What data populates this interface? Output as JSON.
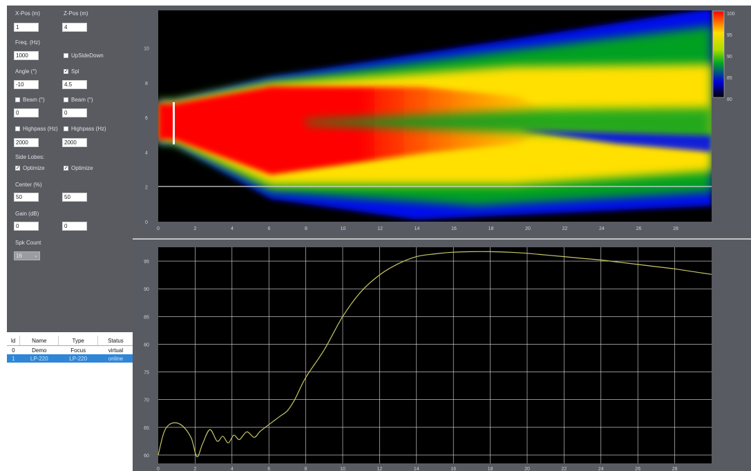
{
  "params": {
    "xpos_label": "X-Pos (m)",
    "zpos_label": "Z-Pos (m)",
    "xpos_value": "1",
    "zpos_value": "4",
    "freq_label": "Freq. (Hz)",
    "freq_value": "1000",
    "upside_label": "UpSideDown",
    "angle_label": "Angle (°)",
    "angle_value": "-10",
    "spl_label": "Spl",
    "spl_value": "4.5",
    "beam1_label": "Beam (°)",
    "beam1_value": "0",
    "beam2_label": "Beam (°)",
    "beam2_value": "0",
    "hp1_label": "Highpass (Hz)",
    "hp1_value": "2000",
    "hp2_label": "Highpass (Hz)",
    "hp2_value": "2000",
    "sidelobes_label": "Side Lobes:",
    "opt1_label": "Optimize",
    "opt2_label": "Optimize",
    "center_label": "Center (%)",
    "center1_value": "50",
    "center2_value": "50",
    "gain_label": "Gain (dB)",
    "gain1_value": "0",
    "gain2_value": "0",
    "spkcount_label": "Spk Count",
    "spkcount_value": "16"
  },
  "devices": {
    "headers": [
      "Id",
      "Name",
      "Type",
      "Status"
    ],
    "rows": [
      [
        "0",
        "Demo",
        "Focus",
        "virtual"
      ],
      [
        "1",
        "LP-220",
        "LP-220",
        "online"
      ]
    ]
  },
  "heatmap": {
    "x_ticks": [
      "0",
      "2",
      "4",
      "6",
      "8",
      "10",
      "12",
      "14",
      "16",
      "18",
      "20",
      "22",
      "24",
      "26",
      "28"
    ],
    "y_ticks": [
      "0",
      "2",
      "4",
      "6",
      "8",
      "10"
    ],
    "colorbar_ticks": [
      "100",
      "95",
      "90",
      "85",
      "80"
    ]
  },
  "chart_data": {
    "type": "line",
    "x_ticks": [
      "0",
      "2",
      "4",
      "6",
      "8",
      "10",
      "12",
      "14",
      "16",
      "18",
      "20",
      "22",
      "24",
      "26",
      "28"
    ],
    "y_ticks": [
      "95",
      "90",
      "85",
      "80",
      "75",
      "70",
      "65",
      "60"
    ],
    "xlim": [
      0,
      30
    ],
    "ylim": [
      58.5,
      97.5
    ],
    "grid": true,
    "series": [
      {
        "color": "#c8c86a",
        "x": [
          0,
          0.3,
          0.6,
          1,
          1.4,
          1.8,
          2.1,
          2.4,
          2.8,
          3.2,
          3.5,
          3.8,
          4.1,
          4.4,
          4.8,
          5.2,
          5.5,
          5.8,
          6.2,
          6.6,
          7,
          7.4,
          8,
          9,
          10,
          11,
          12,
          13,
          14,
          15,
          16,
          17,
          18,
          19,
          20,
          21,
          22,
          23,
          24,
          25,
          26,
          27,
          28,
          29,
          30
        ],
        "y": [
          60,
          64,
          65.5,
          65.8,
          65,
          63,
          59.7,
          62,
          64.6,
          62.5,
          63.4,
          62.2,
          63.6,
          62.8,
          64.2,
          63.2,
          64.2,
          65,
          66,
          67,
          68,
          70,
          74,
          79,
          85,
          89.5,
          92.5,
          94.5,
          95.8,
          96.3,
          96.6,
          96.7,
          96.7,
          96.6,
          96.4,
          96.1,
          95.8,
          95.5,
          95.2,
          94.8,
          94.4,
          94,
          93.6,
          93.1,
          92.6
        ]
      }
    ]
  },
  "colors": {
    "panel": "#5a5b61",
    "plot_bg": "#000000",
    "curve": "#c8c86a",
    "selection": "#2f86d6"
  }
}
